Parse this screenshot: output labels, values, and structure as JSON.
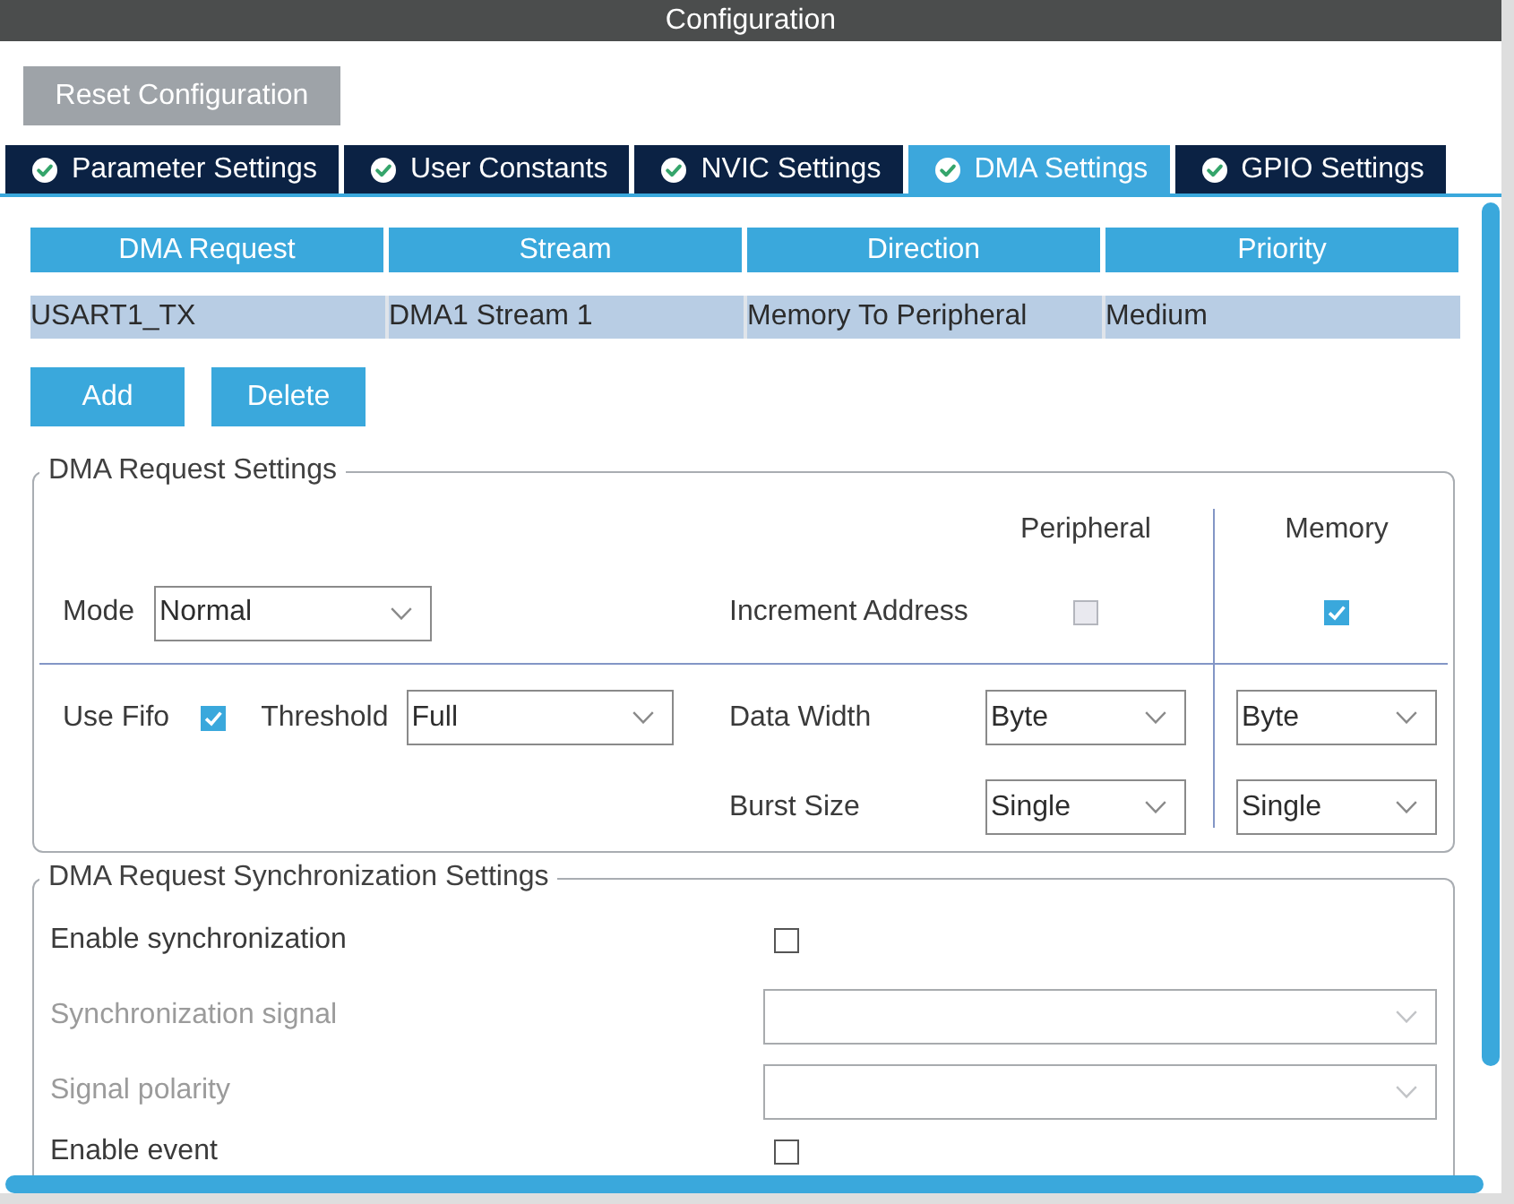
{
  "window": {
    "title": "Configuration"
  },
  "toolbar": {
    "reset_button": "Reset Configuration"
  },
  "tabs": [
    {
      "label": "Parameter Settings",
      "selected": false
    },
    {
      "label": "User Constants",
      "selected": false
    },
    {
      "label": "NVIC Settings",
      "selected": false
    },
    {
      "label": "DMA Settings",
      "selected": true
    },
    {
      "label": "GPIO Settings",
      "selected": false
    }
  ],
  "dma_table": {
    "columns": [
      "DMA Request",
      "Stream",
      "Direction",
      "Priority"
    ],
    "rows": [
      {
        "cells": [
          "USART1_TX",
          "DMA1 Stream 1",
          "Memory To Peripheral",
          "Medium"
        ],
        "selected": true
      }
    ]
  },
  "table_buttons": [
    "Add",
    "Delete"
  ],
  "request_settings": {
    "title": "DMA Request Settings",
    "peripheral_header": "Peripheral",
    "memory_header": "Memory",
    "mode": {
      "label": "Mode",
      "value": "Normal"
    },
    "increment_address": {
      "label": "Increment Address",
      "peripheral": {
        "checked": false,
        "disabled": true
      },
      "memory": {
        "checked": true,
        "disabled": false
      }
    },
    "use_fifo": {
      "label": "Use Fifo",
      "checked": true
    },
    "threshold": {
      "label": "Threshold",
      "value": "Full"
    },
    "data_width": {
      "label": "Data Width",
      "peripheral": "Byte",
      "memory": "Byte"
    },
    "burst_size": {
      "label": "Burst Size",
      "peripheral": "Single",
      "memory": "Single"
    }
  },
  "synchronization_settings": {
    "title": "DMA Request Synchronization Settings",
    "rows": [
      {
        "kind": "checkbox",
        "label": "Enable synchronization",
        "checked": false,
        "disabled": false
      },
      {
        "kind": "select",
        "label": "Synchronization signal",
        "disabled": true
      },
      {
        "kind": "select",
        "label": "Signal polarity",
        "disabled": true
      },
      {
        "kind": "checkbox",
        "label": "Enable event",
        "checked": false,
        "disabled": false
      }
    ]
  }
}
